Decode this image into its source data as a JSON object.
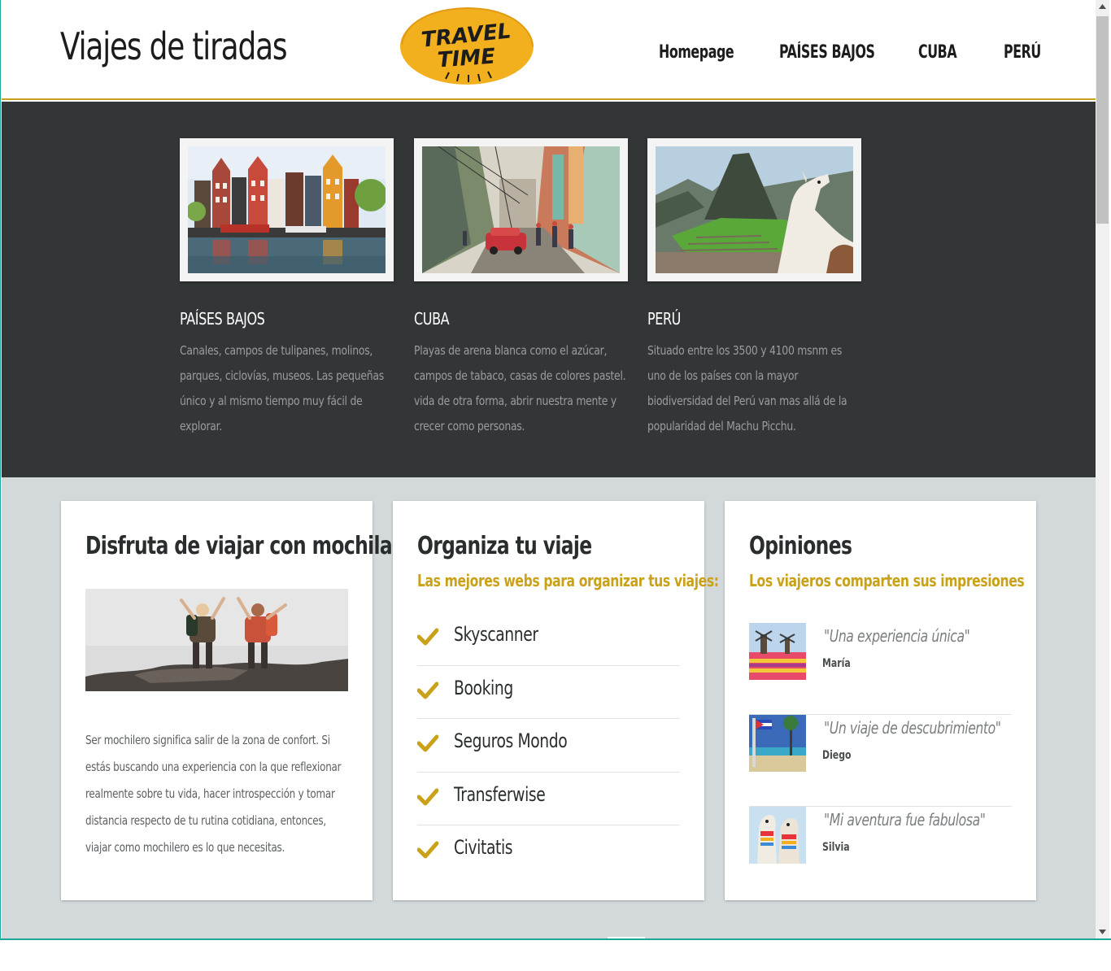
{
  "header": {
    "site_title": "Viajes de tiradas",
    "logo_line1": "TRAVEL",
    "logo_line2": "TIME",
    "nav": [
      "Homepage",
      "PAÍSES BAJOS",
      "CUBA",
      "PERÚ"
    ]
  },
  "destinations": [
    {
      "title": "PAÍSES BAJOS",
      "text": "Canales, campos de tulipanes, molinos, parques, ciclovías, museos. Las pequeñas único y al mismo tiempo muy fácil de explorar."
    },
    {
      "title": "CUBA",
      "text": "Playas de arena blanca como el azúcar, campos de tabaco, casas de colores pastel. vida de otra forma, abrir nuestra mente y crecer como personas."
    },
    {
      "title": "PERÚ",
      "text": "Situado entre los 3500 y 4100 msnm es uno de los países con la mayor biodiversidad del Perú van mas allá de la popularidad del Machu Picchu."
    }
  ],
  "mochila": {
    "title": "Disfruta de viajar con mochila",
    "text": "Ser mochilero significa salir de la zona de confort. Si estás buscando una experiencia con la que reflexionar realmente sobre tu vida, hacer introspección y tomar distancia respecto de tu rutina cotidiana, entonces, viajar como mochilero es lo que necesitas."
  },
  "organiza": {
    "title": "Organiza tu viaje",
    "subtitle": "Las mejores webs para organizar tus viajes:",
    "sites": [
      "Skyscanner",
      "Booking",
      "Seguros Mondo",
      "Transferwise",
      "Civitatis"
    ]
  },
  "opiniones": {
    "title": "Opiniones",
    "subtitle": "Los viajeros comparten sus impresiones",
    "items": [
      {
        "quote": "\"Una experiencia única\"",
        "name": "María"
      },
      {
        "quote": "\"Un viaje de descubrimiento\"",
        "name": "Diego"
      },
      {
        "quote": "\"Mi aventura fue fabulosa\"",
        "name": "Silvia"
      }
    ]
  },
  "colors": {
    "accent": "#c9a21a",
    "hero_bg": "#333637",
    "lower_bg": "#d3d8da",
    "logo_yellow": "#f2b01e"
  }
}
